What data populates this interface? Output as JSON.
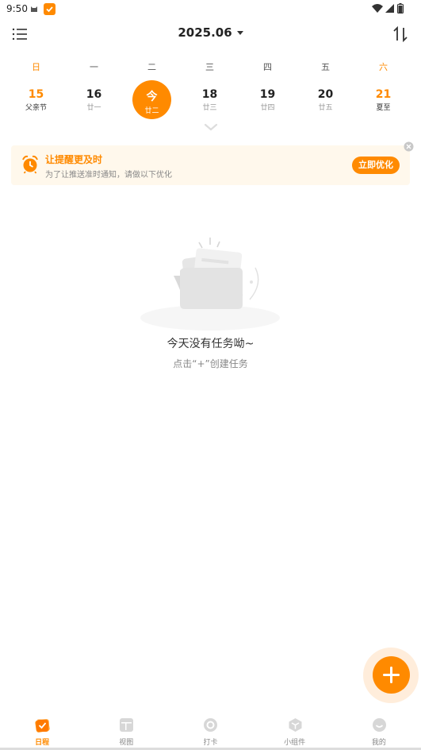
{
  "status": {
    "time": "9:50"
  },
  "header": {
    "month": "2025.06"
  },
  "week": {
    "weekdays": [
      "日",
      "一",
      "二",
      "三",
      "四",
      "五",
      "六"
    ],
    "dates": [
      {
        "num": "15",
        "lunar": "父亲节"
      },
      {
        "num": "16",
        "lunar": "廿一"
      },
      {
        "num": "今",
        "lunar": "廿二"
      },
      {
        "num": "18",
        "lunar": "廿三"
      },
      {
        "num": "19",
        "lunar": "廿四"
      },
      {
        "num": "20",
        "lunar": "廿五"
      },
      {
        "num": "21",
        "lunar": "夏至"
      }
    ]
  },
  "banner": {
    "title": "让提醒更及时",
    "subtitle": "为了让推送准时通知，请做以下优化",
    "button": "立即优化"
  },
  "empty": {
    "title": "今天没有任务呦~",
    "subtitle": "点击“+”创建任务"
  },
  "nav": [
    {
      "label": "日程"
    },
    {
      "label": "视图"
    },
    {
      "label": "打卡"
    },
    {
      "label": "小组件"
    },
    {
      "label": "我的"
    }
  ],
  "colors": {
    "accent": "#ff8a00",
    "banner_bg": "#fff8ec"
  }
}
